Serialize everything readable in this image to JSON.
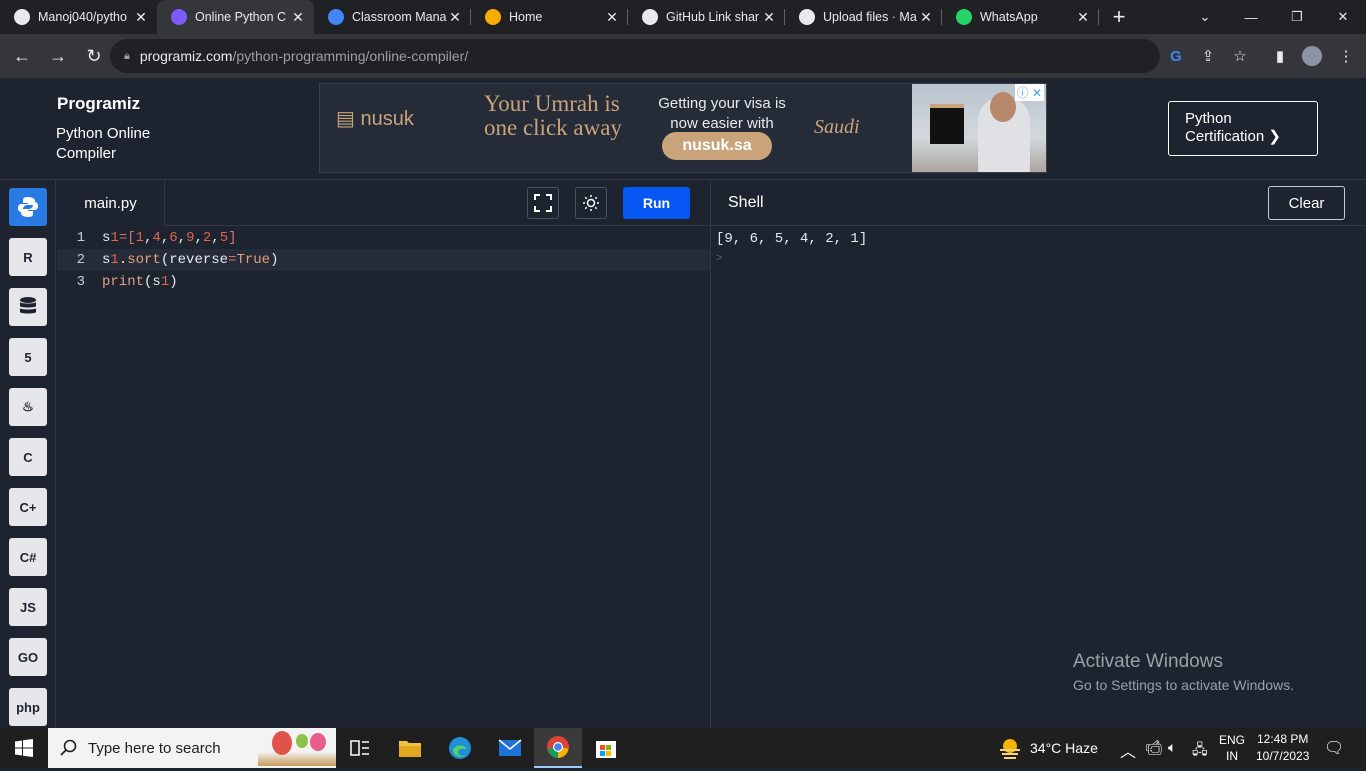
{
  "browser": {
    "tabs": [
      {
        "title": "Manoj040/pytho",
        "icon": "github-icon",
        "color": "#e8eaed"
      },
      {
        "title": "Online Python C",
        "icon": "programiz-icon",
        "color": "#7c5cff"
      },
      {
        "title": "Classroom Mana",
        "icon": "google-icon",
        "color": "#4285f4"
      },
      {
        "title": "Home",
        "icon": "google-classroom-icon",
        "color": "#f9ab00"
      },
      {
        "title": "GitHub Link shar",
        "icon": "contact-card-icon",
        "color": "#e8eaed"
      },
      {
        "title": "Upload files · Ma",
        "icon": "github-icon",
        "color": "#e8eaed"
      },
      {
        "title": "WhatsApp",
        "icon": "whatsapp-icon",
        "color": "#25d366"
      }
    ],
    "active_tab_index": 1,
    "url_host": "programiz.com",
    "url_path": "/python-programming/online-compiler/"
  },
  "site": {
    "brand": "Programiz",
    "subtitle": "Python Online Compiler",
    "certification_label_line1": "Python",
    "certification_label_line2": "Certification ❯"
  },
  "ad": {
    "brand": "nusuk",
    "headline": "Your Umrah is one click away",
    "text": "Getting your visa is now easier with",
    "cta": "nusuk.sa",
    "tagline": "Saudi"
  },
  "languages": [
    {
      "name": "python-icon",
      "label": "",
      "active": true
    },
    {
      "name": "r-icon",
      "label": "R",
      "active": false
    },
    {
      "name": "sql-icon",
      "label": "",
      "active": false
    },
    {
      "name": "html5-icon",
      "label": "5",
      "active": false
    },
    {
      "name": "java-icon",
      "label": "♨",
      "active": false
    },
    {
      "name": "c-icon",
      "label": "C",
      "active": false
    },
    {
      "name": "cpp-icon",
      "label": "C+",
      "active": false
    },
    {
      "name": "csharp-icon",
      "label": "C#",
      "active": false
    },
    {
      "name": "javascript-icon",
      "label": "JS",
      "active": false
    },
    {
      "name": "go-icon",
      "label": "GO",
      "active": false
    },
    {
      "name": "php-icon",
      "label": "php",
      "active": false
    }
  ],
  "editor": {
    "filename": "main.py",
    "run_label": "Run",
    "lines": [
      {
        "num": "1",
        "text": "s1=[1,4,6,9,2,5]"
      },
      {
        "num": "2",
        "text": "s1.sort(reverse=True)"
      },
      {
        "num": "3",
        "text": "print(s1)"
      }
    ],
    "current_line": 2
  },
  "shell": {
    "title": "Shell",
    "clear_label": "Clear",
    "output": "[9, 6, 5, 4, 2, 1]",
    "prompt": ">"
  },
  "watermark": {
    "line1": "Activate Windows",
    "line2": "Go to Settings to activate Windows."
  },
  "taskbar": {
    "search_placeholder": "Type here to search",
    "weather": "34°C  Haze",
    "lang_line1": "ENG",
    "lang_line2": "IN",
    "time": "12:48 PM",
    "date": "10/7/2023"
  }
}
